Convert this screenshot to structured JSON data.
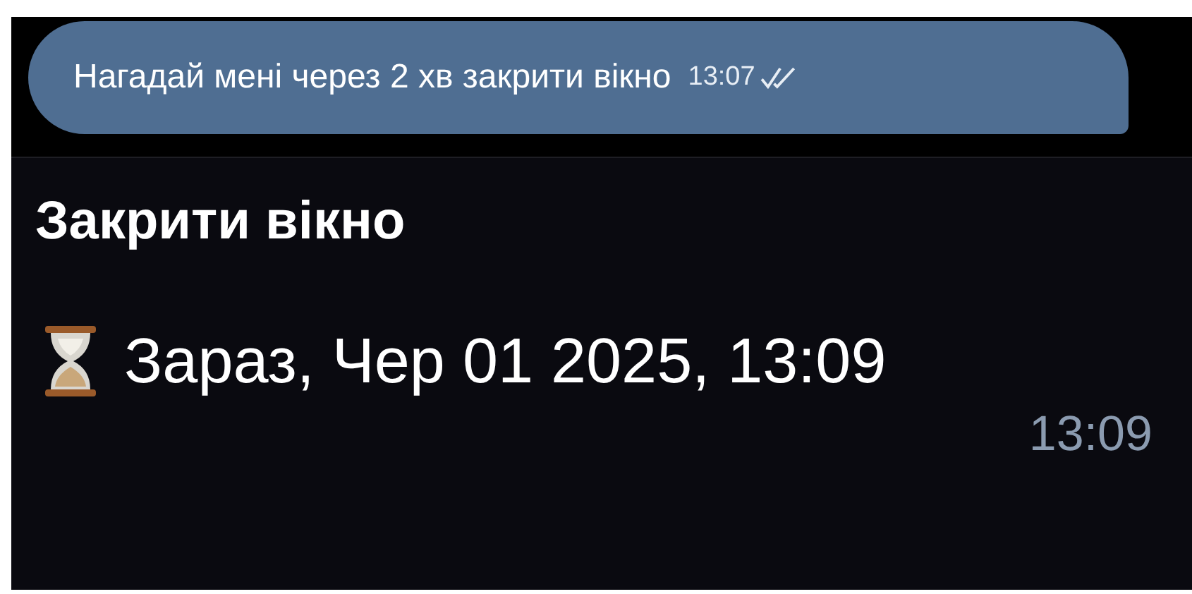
{
  "outgoing_message": {
    "text": "Нагадай мені через 2 хв закрити вікно",
    "time": "13:07",
    "read": true
  },
  "reminder_message": {
    "title": "Закрити вікно",
    "due": "Зараз, Чер 01 2025, 13:09",
    "time": "13:09"
  }
}
